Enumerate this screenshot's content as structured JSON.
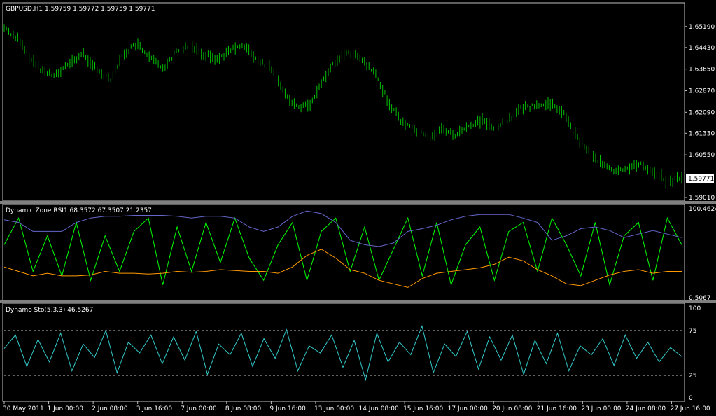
{
  "chart_data": [
    {
      "type": "line",
      "panel": "price",
      "title": "GBPUSD,H1  1.59759 1.59772 1.59759 1.59771",
      "ylim": [
        1.5901,
        1.6559
      ],
      "yticks": [
        "1.65190",
        "1.64430",
        "1.63650",
        "1.62870",
        "1.62090",
        "1.61330",
        "1.60550",
        "1.59010"
      ],
      "last_price_label": "1.59771",
      "x": [
        "30 May 2011",
        "1 Jun 00:00",
        "2 Jun 08:00",
        "3 Jun 16:00",
        "7 Jun 00:00",
        "8 Jun 08:00",
        "9 Jun 16:00",
        "13 Jun 00:00",
        "14 Jun 08:00",
        "15 Jun 16:00",
        "17 Jun 00:00",
        "20 Jun 08:00",
        "21 Jun 16:00",
        "23 Jun 00:00",
        "24 Jun 08:00",
        "27 Jun 16:00"
      ],
      "series": [
        {
          "values": [
            1.6515,
            1.6475,
            1.64,
            1.6355,
            1.6345,
            1.639,
            1.642,
            1.636,
            1.633,
            1.642,
            1.6455,
            1.64,
            1.637,
            1.643,
            1.6455,
            1.642,
            1.64,
            1.643,
            1.6455,
            1.6395,
            1.637,
            1.6285,
            1.623,
            1.6235,
            1.6325,
            1.64,
            1.6425,
            1.6395,
            1.634,
            1.624,
            1.617,
            1.6145,
            1.6115,
            1.615,
            1.6125,
            1.616,
            1.618,
            1.615,
            1.6185,
            1.6225,
            1.623,
            1.624,
            1.6215,
            1.6125,
            1.607,
            1.602,
            1.599,
            1.601,
            1.602,
            1.599,
            1.5955,
            1.5977
          ],
          "color": "#00c000"
        }
      ]
    },
    {
      "type": "line",
      "panel": "rsi",
      "title": "Dynamic Zone RSI1 68.3572 67.3507 21.2357",
      "ylim": [
        0.5067,
        100.4624
      ],
      "yticks": [
        "100.4624",
        "0.5067"
      ],
      "series": [
        {
          "values": [
            60,
            90,
            30,
            70,
            25,
            85,
            20,
            70,
            30,
            75,
            90,
            15,
            80,
            30,
            85,
            40,
            90,
            45,
            20,
            60,
            85,
            20,
            75,
            90,
            30,
            80,
            20,
            55,
            90,
            25,
            85,
            15,
            60,
            80,
            20,
            75,
            85,
            30,
            90,
            60,
            25,
            85,
            15,
            70,
            85,
            20,
            90,
            60
          ],
          "color": "#00ff00"
        },
        {
          "values": [
            88,
            85,
            75,
            75,
            75,
            85,
            90,
            92,
            92,
            93,
            93,
            93,
            92,
            90,
            92,
            92,
            90,
            80,
            75,
            80,
            92,
            98,
            95,
            85,
            65,
            60,
            58,
            62,
            75,
            78,
            82,
            88,
            92,
            94,
            94,
            94,
            90,
            85,
            65,
            70,
            78,
            80,
            76,
            68,
            72,
            76,
            72,
            68
          ],
          "color": "#6666cc"
        },
        {
          "values": [
            35,
            30,
            25,
            28,
            25,
            25,
            26,
            30,
            28,
            28,
            27,
            28,
            30,
            29,
            30,
            32,
            31,
            30,
            30,
            28,
            35,
            48,
            55,
            45,
            32,
            28,
            20,
            16,
            12,
            22,
            28,
            30,
            32,
            34,
            38,
            46,
            42,
            32,
            25,
            16,
            14,
            20,
            26,
            30,
            32,
            28,
            30,
            30
          ],
          "color": "#ff9900"
        }
      ]
    },
    {
      "type": "line",
      "panel": "stochastic",
      "title": "Dynamo Sto(5,3,3) 46.5267",
      "ylim": [
        0,
        100
      ],
      "yticks": [
        "100",
        "75",
        "25",
        "0"
      ],
      "levels": [
        75,
        25
      ],
      "series": [
        {
          "values": [
            55,
            70,
            35,
            65,
            40,
            72,
            30,
            60,
            45,
            75,
            28,
            62,
            50,
            70,
            38,
            68,
            42,
            74,
            26,
            60,
            48,
            72,
            35,
            66,
            44,
            76,
            30,
            58,
            50,
            70,
            34,
            64,
            20,
            72,
            40,
            62,
            48,
            80,
            28,
            60,
            46,
            74,
            32,
            68,
            42,
            70,
            26,
            64,
            38,
            72,
            30,
            58,
            48,
            66,
            36,
            70,
            44,
            62,
            40,
            56,
            46
          ],
          "color": "#33cccc"
        }
      ]
    }
  ]
}
